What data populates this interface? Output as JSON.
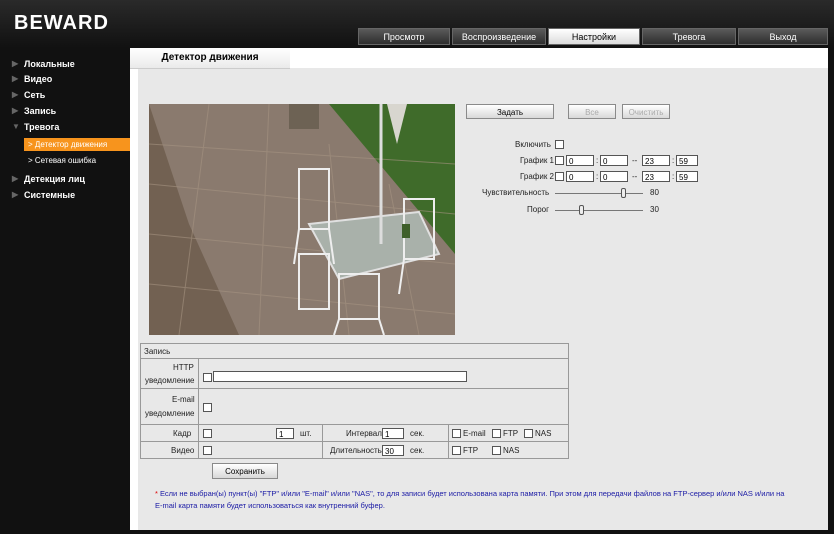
{
  "app": {
    "logo": "BEWARD"
  },
  "nav": {
    "tabs": [
      {
        "label": "Просмотр"
      },
      {
        "label": "Воспроизведение"
      },
      {
        "label": "Настройки"
      },
      {
        "label": "Тревога"
      },
      {
        "label": "Выход"
      }
    ]
  },
  "sidebar": {
    "items": [
      {
        "label": "Локальные"
      },
      {
        "label": "Видео"
      },
      {
        "label": "Сеть"
      },
      {
        "label": "Запись"
      },
      {
        "label": "Тревога"
      },
      {
        "label": "Детектор движения"
      },
      {
        "label": "Сетевая ошибка"
      },
      {
        "label": "Детекция лиц"
      },
      {
        "label": "Системные"
      }
    ]
  },
  "page": {
    "title": "Детектор движения"
  },
  "area_buttons": {
    "set": "Задать",
    "all": "Все",
    "clear": "Очистить"
  },
  "settings": {
    "enable_label": "Включить",
    "schedule1_label": "График 1",
    "schedule1": {
      "from_h": "0",
      "from_m": "0",
      "to_h": "23",
      "to_m": "59"
    },
    "schedule2_label": "График 2",
    "schedule2": {
      "from_h": "0",
      "from_m": "0",
      "to_h": "23",
      "to_m": "59"
    },
    "dash": "--",
    "colon": ":",
    "sensitivity_label": "Чувствительность",
    "sensitivity_value": "80",
    "threshold_label": "Порог",
    "threshold_value": "30"
  },
  "record": {
    "section_label": "Запись",
    "http_label_1": "HTTP",
    "http_label_2": "уведомление",
    "email_label_1": "E-mail",
    "email_label_2": "уведомление",
    "frame_label": "Кадр",
    "frame_count": "1",
    "frame_unit": "шт.",
    "interval_label": "Интервал",
    "interval_value": "1",
    "interval_unit": "сек.",
    "video_label": "Видео",
    "duration_label": "Длительность",
    "duration_value": "30",
    "duration_unit": "сек.",
    "opt_email": "E-mail",
    "opt_ftp": "FTP",
    "opt_nas": "NAS",
    "save_button": "Сохранить"
  },
  "footnote": {
    "star": "*",
    "text_line1": "Если не выбран(ы) пункт(ы) \"FTP\" и/или \"E-mail\" и/или \"NAS\", то для записи будет использована карта памяти. При этом для передачи файлов на FTP-сервер и/или NAS и/или на",
    "text_line2": "E-mail карта памяти будет использоваться как внутренний буфер."
  },
  "colors": {
    "accent": "#f7941d",
    "note": "#1a1aa5",
    "panel": "#e8e8e8",
    "frame": "#111111"
  },
  "icons": {
    "sidebar_bullet": "triangle-right-icon",
    "submenu_bullet": "chevron-right-icon"
  }
}
